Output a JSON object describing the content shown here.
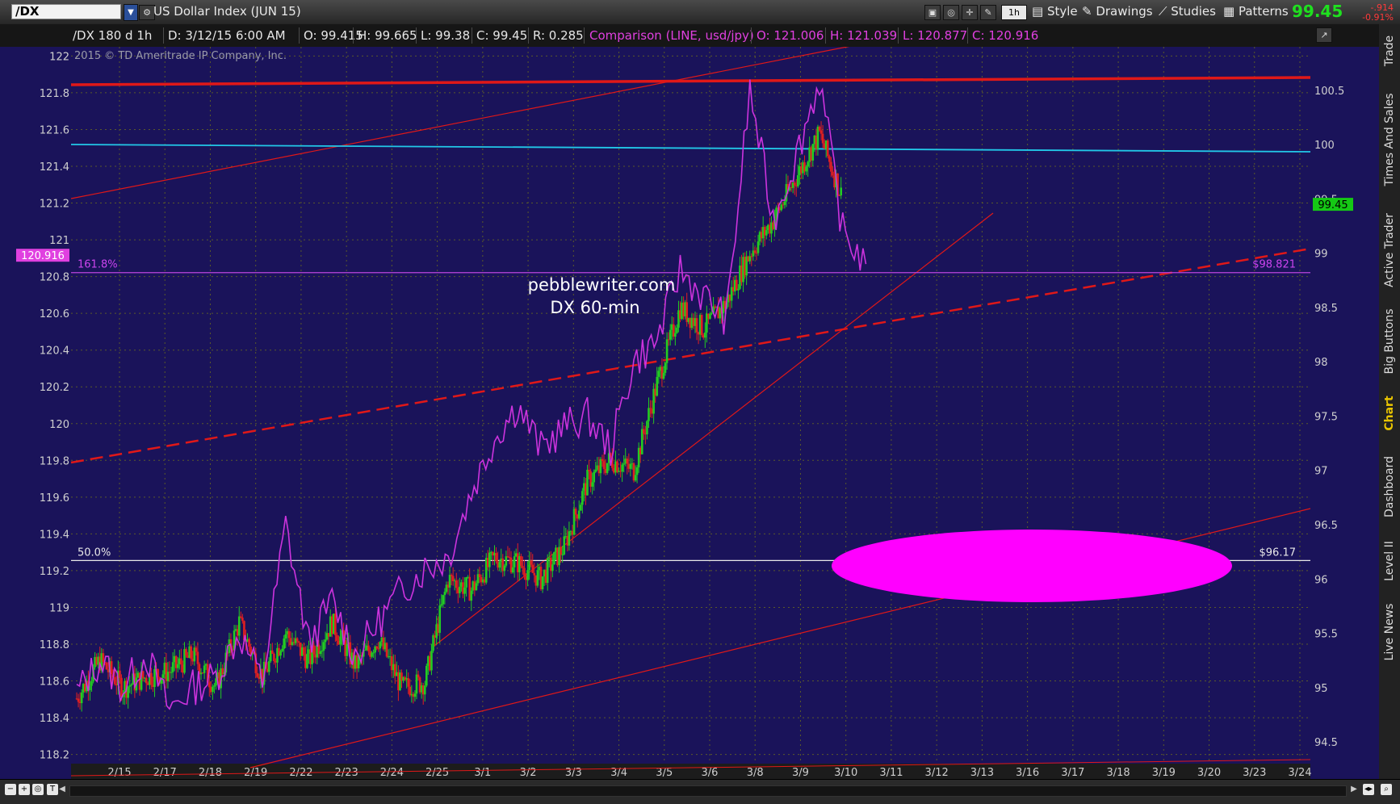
{
  "toolbar": {
    "symbol": "/DX",
    "title": "US Dollar Index (JUN 15)",
    "period_button": "1h",
    "style_label": "Style",
    "drawings_label": "Drawings",
    "studies_label": "Studies",
    "patterns_label": "Patterns",
    "last_price": "99.45",
    "change": "-.914",
    "change_pct": "-0.91%"
  },
  "quote": {
    "spec": "/DX 180 d 1h",
    "date": "D: 3/12/15 6:00 AM",
    "open": "O: 99.415",
    "high": "H: 99.665",
    "low": "L: 99.38",
    "close": "C: 99.45",
    "range": "R: 0.285",
    "comparison": "Comparison (LINE, usd/jpy)",
    "cmp_open": "O: 121.006",
    "cmp_high": "H: 121.039",
    "cmp_low": "L: 120.877",
    "cmp_close": "C: 120.916"
  },
  "sidebar": [
    "Trade",
    "Times And Sales",
    "Active Trader",
    "Big Buttons",
    "Chart",
    "Dashboard",
    "Level II",
    "Live News"
  ],
  "colors": {
    "plot_bg": "#1a135a",
    "grid": "#5a5a2a",
    "up": "#22cc22",
    "down": "#e02020",
    "comparison": "#cc33dd",
    "trend_red": "#e01818",
    "cyan": "#22c8e8",
    "ellipse": "#ff00ff",
    "fib": "#bb44dd"
  },
  "chart_data": {
    "type": "line",
    "copyright": "2015 © TD Ameritrade IP Company, Inc.",
    "annotation_lines": [
      "pebblewriter.com",
      "DX 60-min"
    ],
    "x_ticks": [
      "2/15",
      "2/17",
      "2/18",
      "2/19",
      "2/22",
      "2/23",
      "2/24",
      "2/25",
      "3/1",
      "3/2",
      "3/3",
      "3/4",
      "3/5",
      "3/6",
      "3/8",
      "3/9",
      "3/10",
      "3/11",
      "3/12",
      "3/13",
      "3/16",
      "3/17",
      "3/18",
      "3/19",
      "3/20",
      "3/23",
      "3/24"
    ],
    "left_axis": {
      "range": [
        118.15,
        122.05
      ],
      "ticks": [
        "122",
        "121.8",
        "121.6",
        "121.4",
        "121.2",
        "121",
        "120.8",
        "120.6",
        "120.4",
        "120.2",
        "120",
        "119.8",
        "119.6",
        "119.4",
        "119.2",
        "119",
        "118.8",
        "118.6",
        "118.4",
        "118.2"
      ]
    },
    "right_axis": {
      "range": [
        94.3,
        100.9
      ],
      "ticks": [
        "100.5",
        "100",
        "99.5",
        "99",
        "98.5",
        "98",
        "97.5",
        "97",
        "96.5",
        "96",
        "95.5",
        "95",
        "94.5"
      ]
    },
    "current_price_label": "99.45",
    "comparison_last_label": "120.916",
    "fib_levels": [
      {
        "label": "161.8%",
        "price_label": "$98.821",
        "value": 98.821
      },
      {
        "label": "50.0%",
        "price_label": "$96.17",
        "value": 96.17
      }
    ],
    "dx_series_day_index": [
      0,
      0.5,
      1,
      1.5,
      2,
      2.5,
      3,
      3.5,
      4,
      4.5,
      5,
      5.5,
      6,
      6.5,
      7,
      7.5,
      8,
      8.5,
      9,
      9.5,
      10,
      10.5,
      11,
      11.5,
      12,
      12.5,
      13,
      13.5,
      14,
      14.5,
      15,
      15.5,
      16,
      16.5,
      17,
      17.5
    ],
    "dx_values": [
      94.9,
      95.25,
      95.0,
      95.1,
      95.15,
      95.3,
      95.0,
      95.6,
      95.1,
      95.5,
      95.25,
      95.6,
      95.2,
      95.45,
      95.0,
      95.05,
      96.0,
      95.9,
      96.2,
      96.15,
      96.0,
      96.3,
      96.9,
      97.1,
      97.0,
      97.8,
      98.5,
      98.3,
      98.55,
      99.0,
      99.3,
      99.7,
      100.1,
      99.5
    ],
    "usdjpy_values": [
      118.6,
      119.2,
      119.0,
      119.25,
      118.7,
      118.9,
      118.8,
      119.3,
      118.9,
      119.5,
      118.7,
      118.9,
      118.6,
      118.9,
      119.1,
      119.2,
      119.3,
      119.6,
      119.9,
      120.0,
      119.8,
      119.95,
      120.0,
      119.8,
      120.2,
      120.3,
      120.85,
      120.7,
      120.6,
      121.8,
      121.2,
      121.5,
      121.85,
      121.1,
      120.9
    ],
    "usdjpy_right_axis_values": [
      94.95,
      95.25,
      95.0,
      95.3,
      94.8,
      95.0,
      95.1,
      95.5,
      95.05,
      96.5,
      95.4,
      95.8,
      95.3,
      95.6,
      95.9,
      96.1,
      96.2,
      96.8,
      97.3,
      97.6,
      97.2,
      97.4,
      97.5,
      97.2,
      98.0,
      98.2,
      98.85,
      98.6,
      98.4,
      100.5,
      99.3,
      99.9,
      100.6,
      99.2,
      98.9
    ]
  }
}
